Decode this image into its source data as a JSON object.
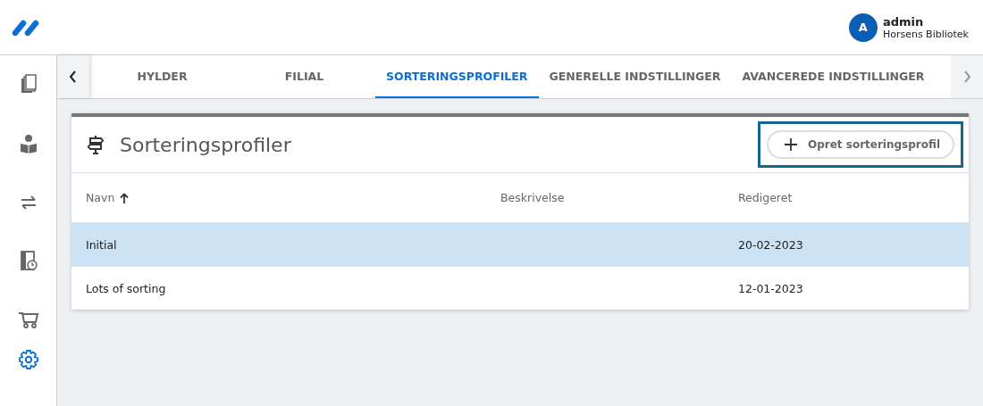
{
  "user": {
    "initial": "A",
    "name": "admin",
    "library": "Horsens Bibliotek"
  },
  "sidebar": {
    "items": [
      {
        "kind": "books",
        "selected": false
      },
      {
        "kind": "reader",
        "selected": false
      },
      {
        "kind": "transfer",
        "selected": false
      },
      {
        "kind": "schedule",
        "selected": false
      },
      {
        "kind": "cart",
        "selected": false
      },
      {
        "kind": "settings",
        "selected": true
      }
    ]
  },
  "tabs": [
    {
      "label": "HYLDER",
      "selected": false
    },
    {
      "label": "FILIAL",
      "selected": false
    },
    {
      "label": "SORTERINGSPROFILER",
      "selected": true
    },
    {
      "label": "GENERELLE INDSTILLINGER",
      "selected": false
    },
    {
      "label": "AVANCEREDE INDSTILLINGER",
      "selected": false
    }
  ],
  "card": {
    "title": "Sorteringsprofiler",
    "create_button": {
      "label": "Opret sorteringsprofil",
      "focused": true
    }
  },
  "table": {
    "columns": [
      {
        "label": "Navn",
        "sorted": true
      },
      {
        "label": "Beskrivelse",
        "sorted": false
      },
      {
        "label": "Redigeret",
        "sorted": false
      }
    ],
    "rows": [
      {
        "cells": [
          "Initial",
          "",
          "20-02-2023"
        ],
        "selected": true
      },
      {
        "cells": [
          "Lots of sorting",
          "",
          "12-01-2023"
        ],
        "selected": false
      }
    ]
  }
}
